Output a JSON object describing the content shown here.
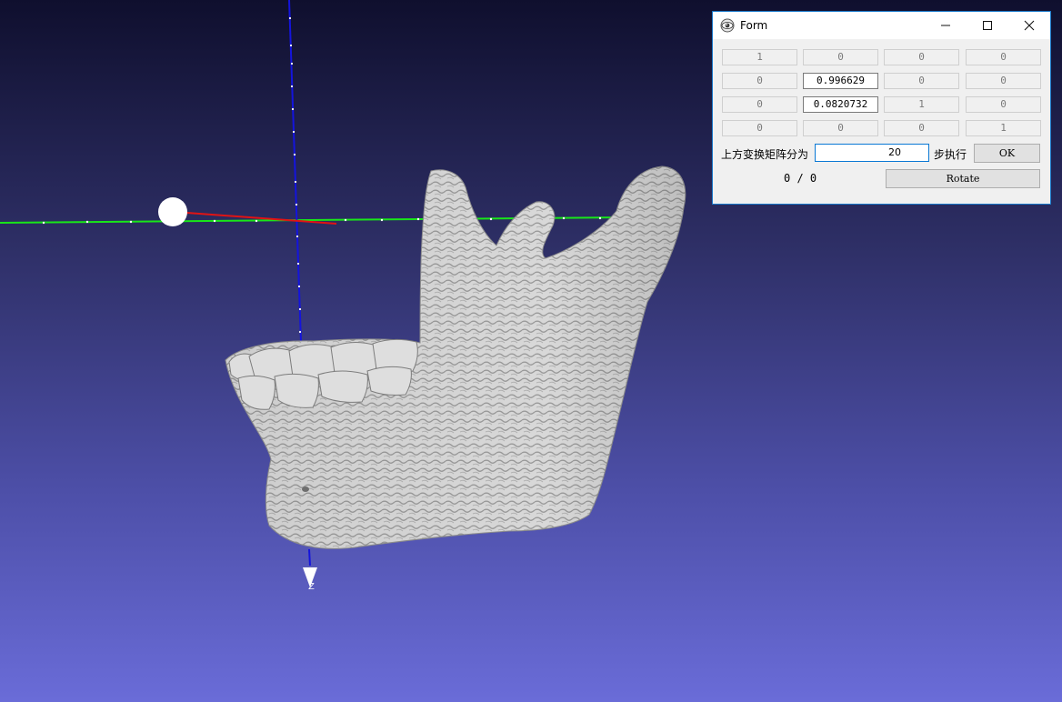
{
  "viewport": {
    "axis_label": "Z",
    "background_colors": [
      "#0f0f2e",
      "#6a6cd8"
    ],
    "model": "mandible-mesh"
  },
  "form": {
    "title": "Form",
    "icon": "app-eye-icon",
    "controls": {
      "minimize": "minimize-icon",
      "maximize": "maximize-icon",
      "close": "close-icon"
    },
    "matrix": [
      [
        "1",
        "0",
        "0",
        "0"
      ],
      [
        "0",
        "0.996629",
        "0",
        "0"
      ],
      [
        "0",
        "0.0820732",
        "1",
        "0"
      ],
      [
        "0",
        "0",
        "0",
        "1"
      ]
    ],
    "steps_label": "上方变换矩阵分为",
    "steps_value": "20",
    "steps_suffix": "步执行",
    "ok_label": "OK",
    "progress": "0 / 0",
    "rotate_label": "Rotate"
  }
}
